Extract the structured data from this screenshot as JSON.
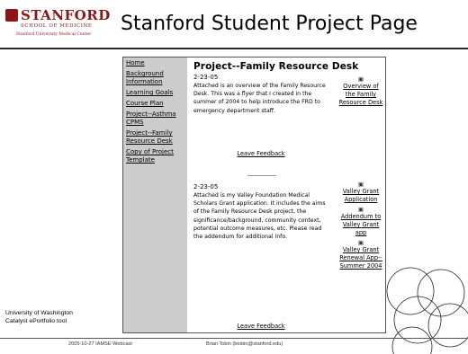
{
  "logo": {
    "name": "STANFORD",
    "line1": "SCHOOL OF MEDICINE",
    "line2": "Stanford University Medical Center"
  },
  "slide_title": "Stanford Student Project Page",
  "sidebar": {
    "links": [
      "Home",
      "Background Information",
      "Learning Goals",
      "Course Plan",
      "Project--Asthma CPMS",
      "Project--Family Resource Desk",
      "Copy of Project Template"
    ]
  },
  "content": {
    "title": "Project--Family Resource Desk",
    "entries": [
      {
        "date": "2-23-05",
        "text": "Attached is an overview of the Family Resource Desk. This was a flyer that I created in the summer of 2004 to help introduce the FRD to emergency department staff.",
        "attachments": [
          "Overview of the Family Resource Desk"
        ],
        "feedback": "Leave Feedback"
      },
      {
        "date": "2-23-05",
        "text": "Attached is my Valley Foundation Medical Scholars Grant application. It includes the aims of the Family Resource Desk project, the significance/background, community context, potential outcome measures, etc. Please read the addendum for additional info.",
        "attachments": [
          "Valley Grant Application",
          "Addendum to Valley Grant app",
          "Valley Grant Renewal App--Summer 2004"
        ],
        "feedback": "Leave Feedback"
      }
    ]
  },
  "caption": {
    "line1": "University of Washington",
    "line2": "Catalyst ePortfolio tool"
  },
  "footer": {
    "left": "2005-10-27 IAMSE Webcast",
    "right": "Brian Tobin (btobin@stanford.edu)"
  },
  "colors": {
    "brand": "#8c1515",
    "sidebar_bg": "#cccccc"
  },
  "icons": {
    "attachment": "document-icon"
  }
}
